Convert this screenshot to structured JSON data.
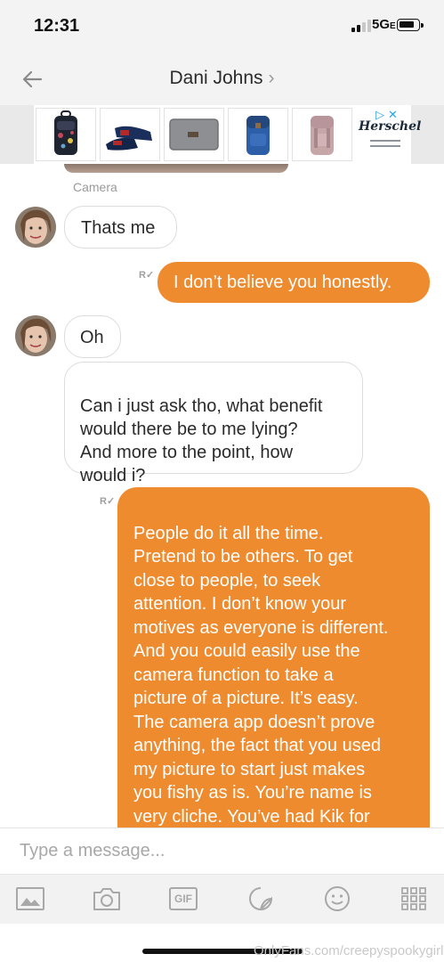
{
  "status_bar": {
    "time": "12:31",
    "network": "5G",
    "network_suffix": "E"
  },
  "header": {
    "contact_name": "Dani Johns",
    "chevron": "›",
    "back_icon": "back-arrow-icon"
  },
  "ad": {
    "brand_name": "Herschel",
    "adchoices_icons": [
      "adchoices-icon",
      "close-icon"
    ],
    "products": [
      "floral-backpack",
      "sandals",
      "grey-laptop-sleeve",
      "blue-backpack",
      "pink-backpack"
    ]
  },
  "chat": {
    "camera_label": "Camera",
    "messages": [
      {
        "direction": "in",
        "text": "Thats me"
      },
      {
        "direction": "out",
        "text": "I don’t believe you honestly.",
        "read_marker": "R"
      },
      {
        "direction": "in",
        "text": "Oh"
      },
      {
        "direction": "in",
        "text": "Can i just ask tho, what benefit\nwould there be to me lying?\nAnd more to the point, how\nwould i?"
      },
      {
        "direction": "out",
        "read_marker": "R",
        "text": "People do it all the time.\nPretend to be others. To get\nclose to people, to seek\nattention. I don’t know your\nmotives as everyone is different.\nAnd you could easily use the\ncamera function to take a\npicture of a picture. It’s easy.\nThe camera app doesn’t prove\nanything, the fact that you used\nmy picture to start just makes\nyou fishy as is. You’re name is\nvery cliche. You’ve had Kik for\nthree days, why would you try to"
      }
    ]
  },
  "composer": {
    "placeholder": "Type a message..."
  },
  "toolbar": {
    "items": [
      "gallery-icon",
      "camera-icon",
      "gif-icon",
      "sticker-icon",
      "emoji-icon",
      "apps-grid-icon"
    ],
    "gif_label": "GIF"
  },
  "watermark": "OnlyFans.com/creepyspookygirl",
  "colors": {
    "outgoing_bubble": "#ef8b2f",
    "adchoices": "#2fa3e6"
  }
}
